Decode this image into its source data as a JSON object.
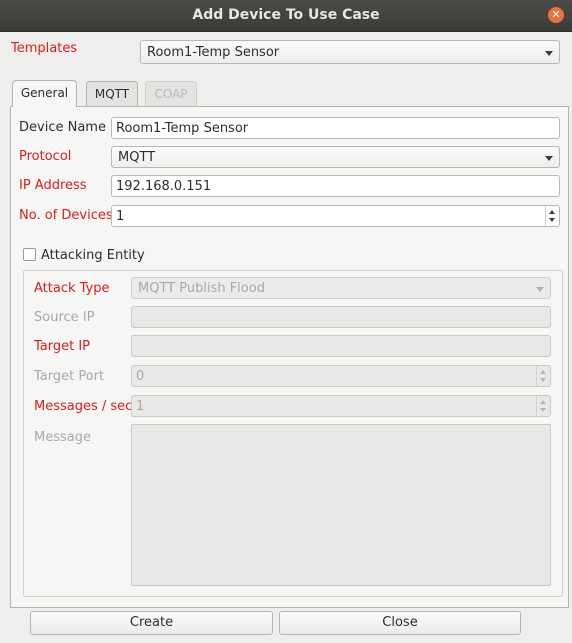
{
  "window": {
    "title": "Add Device To Use Case",
    "close_glyph": "✕"
  },
  "templates": {
    "label": "Templates",
    "value": "Room1-Temp Sensor"
  },
  "tabs": [
    {
      "label": "General",
      "state": "active"
    },
    {
      "label": "MQTT",
      "state": "normal"
    },
    {
      "label": "COAP",
      "state": "disabled"
    }
  ],
  "general": {
    "device_name": {
      "label": "Device Name",
      "value": "Room1-Temp Sensor"
    },
    "protocol": {
      "label": "Protocol",
      "value": "MQTT"
    },
    "ip_address": {
      "label": "IP Address",
      "value": "192.168.0.151"
    },
    "num_devices": {
      "label": "No. of Devices",
      "value": "1"
    }
  },
  "attack": {
    "checkbox_label": "Attacking Entity",
    "checked": false,
    "attack_type": {
      "label": "Attack Type",
      "value": "MQTT Publish Flood"
    },
    "source_ip": {
      "label": "Source IP",
      "value": ""
    },
    "target_ip": {
      "label": "Target IP",
      "value": ""
    },
    "target_port": {
      "label": "Target Port",
      "value": "0"
    },
    "messages_per_sec": {
      "label": "Messages / sec",
      "value": "1"
    },
    "message": {
      "label": "Message",
      "value": ""
    }
  },
  "buttons": {
    "create": "Create",
    "close": "Close"
  },
  "colors": {
    "required_label": "#d81e1e",
    "disabled_text": "#a8a8a6",
    "titlebar": "#3f3f3c"
  }
}
